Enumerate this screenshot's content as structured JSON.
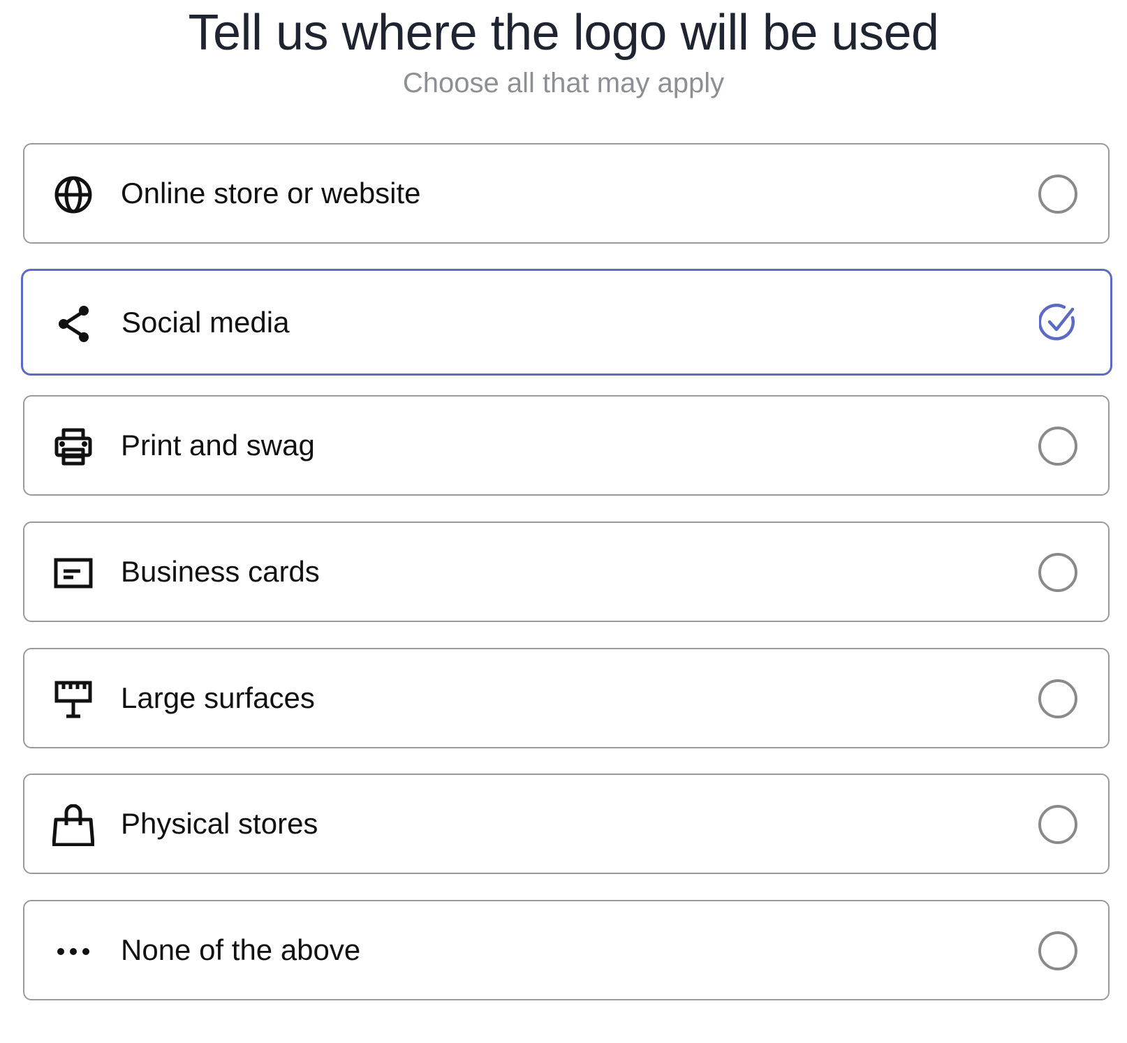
{
  "header": {
    "title": "Tell us where the logo will be used",
    "subtitle": "Choose all that may apply"
  },
  "colors": {
    "accent": "#5c6ac4",
    "border": "#9a9a9a",
    "title": "#1f2530",
    "subtitle": "#8c8f94"
  },
  "options": [
    {
      "label": "Online store or website",
      "icon": "globe-icon",
      "selected": false
    },
    {
      "label": "Social media",
      "icon": "share-icon",
      "selected": true
    },
    {
      "label": "Print and swag",
      "icon": "printer-icon",
      "selected": false
    },
    {
      "label": "Business cards",
      "icon": "card-icon",
      "selected": false
    },
    {
      "label": "Large surfaces",
      "icon": "billboard-icon",
      "selected": false
    },
    {
      "label": "Physical stores",
      "icon": "shopping-bag-icon",
      "selected": false
    },
    {
      "label": "None of the above",
      "icon": "more-horizontal-icon",
      "selected": false
    }
  ]
}
